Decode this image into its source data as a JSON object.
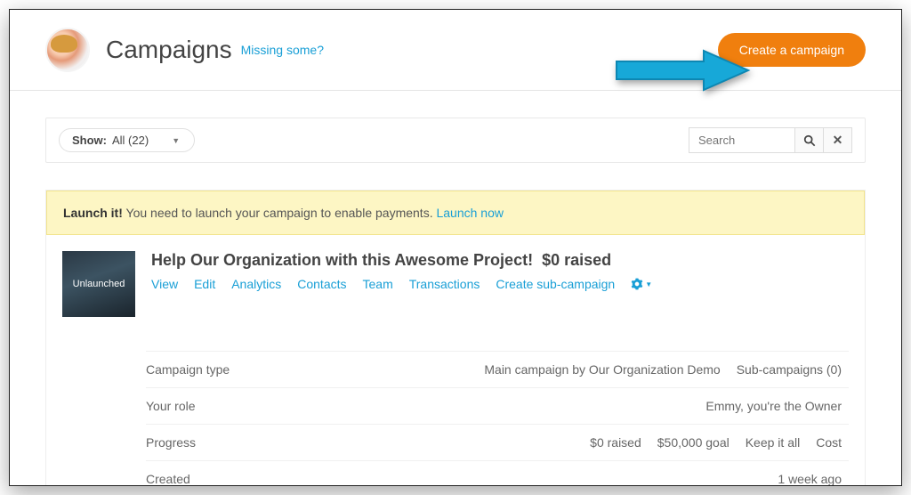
{
  "header": {
    "title": "Campaigns",
    "missing_link": "Missing some?",
    "create_label": "Create a campaign"
  },
  "filter": {
    "show_label": "Show:",
    "show_value": "All (22)",
    "search_placeholder": "Search"
  },
  "banner": {
    "strong": "Launch it!",
    "text": "You need to launch your campaign to enable payments.",
    "link": "Launch now"
  },
  "campaign": {
    "thumbnail_label": "Unlaunched",
    "title": "Help Our Organization with this Awesome Project!",
    "raised": "$0 raised",
    "actions": [
      "View",
      "Edit",
      "Analytics",
      "Contacts",
      "Team",
      "Transactions",
      "Create sub-campaign"
    ]
  },
  "details": [
    {
      "label": "Campaign type",
      "values": [
        "Main campaign by Our Organization Demo",
        "Sub-campaigns (0)"
      ]
    },
    {
      "label": "Your role",
      "values": [
        "Emmy, you're the Owner"
      ]
    },
    {
      "label": "Progress",
      "values": [
        "$0 raised",
        "$50,000 goal",
        "Keep it all",
        "Cost"
      ]
    },
    {
      "label": "Created",
      "values": [
        "1 week ago"
      ]
    }
  ]
}
